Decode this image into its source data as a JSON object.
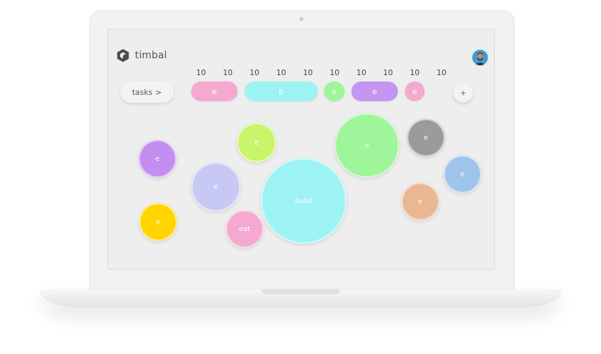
{
  "app": {
    "name": "timbal"
  },
  "header": {
    "counts": [
      "10",
      "10",
      "10",
      "10",
      "10",
      "10",
      "10",
      "10",
      "10",
      "10"
    ]
  },
  "toolbar": {
    "tasks_label": "tasks",
    "tasks_arrow": ">",
    "add_label": "+",
    "pills": [
      {
        "label": "e",
        "color": "#f5a9d0"
      },
      {
        "label": "b",
        "color": "#9df3f3"
      },
      {
        "label": "e",
        "color": "#9ef59a"
      },
      {
        "label": "e",
        "color": "#c496f2"
      },
      {
        "label": "e",
        "color": "#f5a9d0"
      }
    ]
  },
  "bubbles": [
    {
      "label": "e",
      "color": "#c38ef0"
    },
    {
      "label": "e",
      "color": "#c8f56a"
    },
    {
      "label": "e",
      "color": "#c8c8f5"
    },
    {
      "label": "build",
      "color": "#9df3f3"
    },
    {
      "label": "e",
      "color": "#9ef59a"
    },
    {
      "label": "e",
      "color": "#9b9b9b"
    },
    {
      "label": "e",
      "color": "#9ec4ec"
    },
    {
      "label": "e",
      "color": "#e9b791"
    },
    {
      "label": "e",
      "color": "#ffd400"
    },
    {
      "label": "eat",
      "color": "#f5a9d0"
    }
  ]
}
